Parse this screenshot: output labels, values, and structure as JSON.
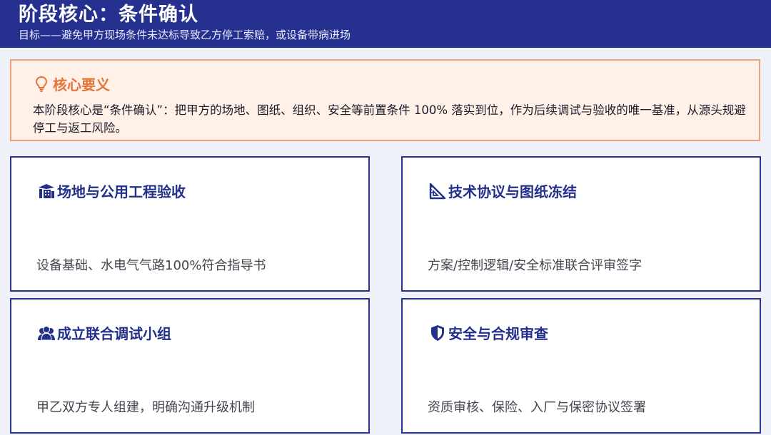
{
  "header": {
    "title": "阶段核心：条件确认",
    "subtitle": "目标——避免甲方现场条件未达标导致乙方停工索赔，或设备带病进场"
  },
  "core": {
    "icon": "lightbulb-icon",
    "title": "核心要义",
    "body": "本阶段核心是“条件确认”：把甲方的场地、图纸、组织、安全等前置条件 100% 落实到位，作为后续调试与验收的唯一基准，从源头规避停工与返工风险。"
  },
  "cards": [
    {
      "icon": "building-icon",
      "title": "场地与公用工程验收",
      "desc": "设备基础、水电气气路100%符合指导书"
    },
    {
      "icon": "ruler-triangle-icon",
      "title": "技术协议与图纸冻结",
      "desc": "方案/控制逻辑/安全标准联合评审签字"
    },
    {
      "icon": "team-icon",
      "title": "成立联合调试小组",
      "desc": "甲乙双方专人组建，明确沟通升级机制"
    },
    {
      "icon": "shield-icon",
      "title": "安全与合规审查",
      "desc": "资质审核、保险、入厂与保密协议签署"
    }
  ],
  "colors": {
    "header_bg": "#26318f",
    "accent_orange": "#e2743a",
    "card_border": "#27328f",
    "page_bg": "#eef1f7"
  }
}
